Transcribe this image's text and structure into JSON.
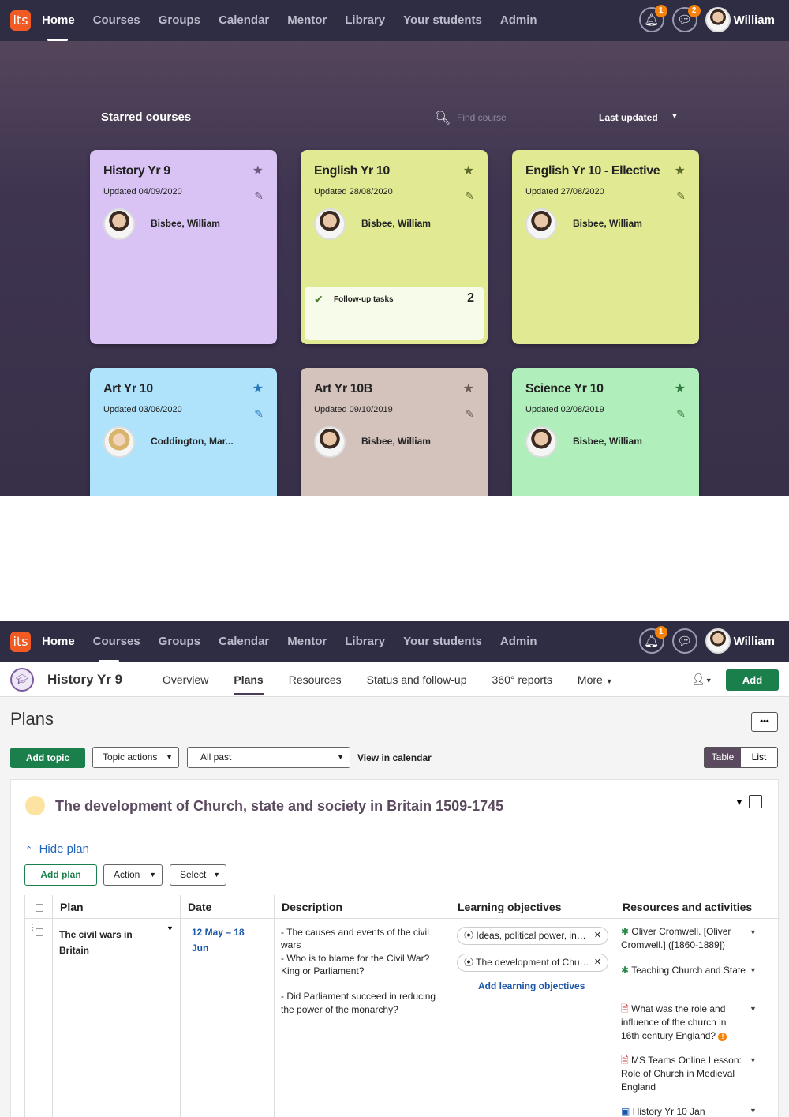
{
  "nav": {
    "logo": "its",
    "items": [
      "Home",
      "Courses",
      "Groups",
      "Calendar",
      "Mentor",
      "Library",
      "Your students",
      "Admin"
    ],
    "user": "William"
  },
  "shot1": {
    "notif_badge": "1",
    "msg_badge": "2",
    "starred_title": "Starred courses",
    "search_placeholder": "Find course",
    "sort_label": "Last updated",
    "cards": [
      {
        "title": "History Yr 9",
        "updated": "Updated 04/09/2020",
        "owner": "Bisbee, William",
        "color": "#d9c3f5",
        "star": "#6a5a80",
        "edit": "#6a5a80"
      },
      {
        "title": "English Yr 10",
        "updated": "Updated 28/08/2020",
        "owner": "Bisbee, William",
        "color": "#e1ea93",
        "star": "#5d6b2a",
        "edit": "#5d6b2a",
        "follow_label": "Follow-up tasks",
        "follow_count": "2"
      },
      {
        "title": "English Yr 10 - Ellective",
        "updated": "Updated 27/08/2020",
        "owner": "Bisbee, William",
        "color": "#e1ea93",
        "star": "#5d6b2a",
        "edit": "#5d6b2a"
      },
      {
        "title": "Art Yr 10",
        "updated": "Updated 03/06/2020",
        "owner": "Coddington, Mar...",
        "color": "#aee3fb",
        "star": "#2777bb",
        "edit": "#2777bb"
      },
      {
        "title": "Art Yr 10B",
        "updated": "Updated 09/10/2019",
        "owner": "Bisbee, William",
        "color": "#d4c2bc",
        "star": "#6e5a55",
        "edit": "#6e5a55"
      },
      {
        "title": "Science Yr 10",
        "updated": "Updated 02/08/2019",
        "owner": "Bisbee, William",
        "color": "#b0eebb",
        "star": "#2f7a3e",
        "edit": "#2f7a3e"
      }
    ]
  },
  "shot2": {
    "notif_badge": "1",
    "course_name": "History Yr 9",
    "tabs": [
      "Overview",
      "Plans",
      "Resources",
      "Status and follow-up",
      "360° reports",
      "More"
    ],
    "add_label": "Add",
    "page_title": "Plans",
    "more_label": "•••",
    "add_topic": "Add topic",
    "topic_actions": "Topic actions",
    "period": "All past",
    "view_calendar": "View in calendar",
    "view_table": "Table",
    "view_list": "List",
    "topic_title": "The development of Church, state and society in Britain 1509-1745",
    "hide_plan": "Hide plan",
    "add_plan": "Add plan",
    "action": "Action",
    "select": "Select",
    "columns": [
      "Plan",
      "Date",
      "Description",
      "Learning objectives",
      "Resources and activities"
    ],
    "row": {
      "plan": "The civil wars in Britain",
      "date": "12 May – 18 Jun",
      "description": "- The causes and events of the civil wars\n- Who is to blame for the Civil War? King or Parliament?\n\n- Did Parliament succeed in reducing the power of the monarchy?",
      "objectives": [
        "Ideas, political power, in…",
        "The development of Chu…"
      ],
      "add_objectives": "Add learning objectives",
      "resources": [
        "Oliver Cromwell. [Oliver Cromwell.] ([1860-1889])",
        "Teaching Church and State",
        "What was the role and influence of the church in 16th century England?",
        "MS Teams Online Lesson: Role of Church in Medieval England",
        "History Yr 10 Jan"
      ]
    }
  }
}
